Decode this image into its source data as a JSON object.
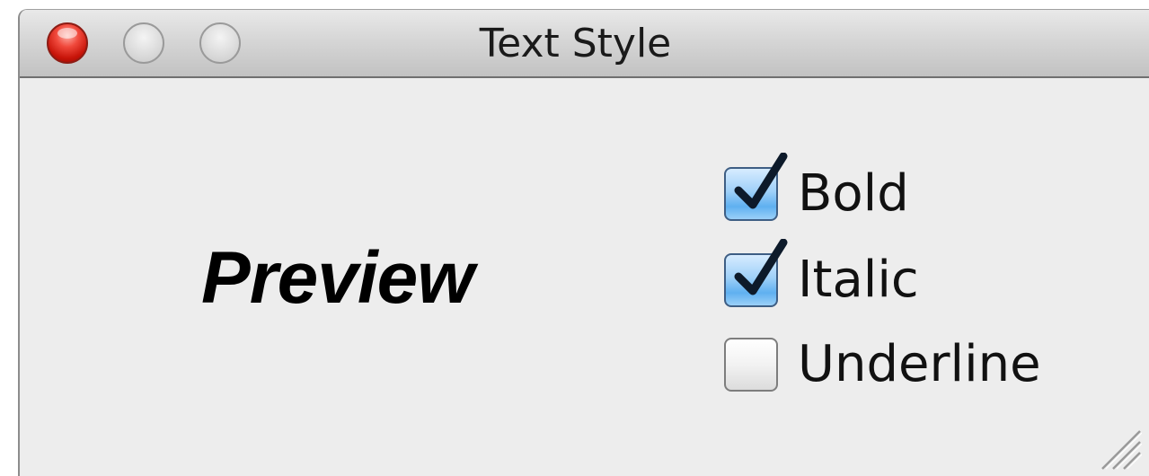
{
  "window": {
    "title": "Text Style"
  },
  "preview": {
    "text": "Preview"
  },
  "options": {
    "bold": {
      "label": "Bold",
      "checked": true
    },
    "italic": {
      "label": "Italic",
      "checked": true
    },
    "underline": {
      "label": "Underline",
      "checked": false
    }
  },
  "icons": {
    "close": "close-button-icon",
    "minimize": "minimize-button-icon",
    "zoom": "zoom-button-icon",
    "checkmark": "checkmark-icon",
    "resize": "resize-grip-icon"
  },
  "colors": {
    "close_red": "#e0281c",
    "checkbox_blue": "#5fb0f0",
    "window_bg": "#ededed"
  }
}
